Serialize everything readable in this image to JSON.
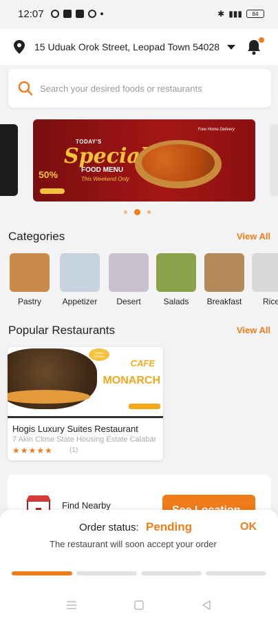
{
  "status_bar": {
    "time": "12:07",
    "battery": "84"
  },
  "address": {
    "text": "15 Uduak Orok Street, Leopad Town 540281, ..."
  },
  "search": {
    "placeholder": "Search your desired foods or restaurants"
  },
  "banner": {
    "line1": "TODAY'S",
    "line2": "Special",
    "line3": "FOOD MENU",
    "line4": "This Weekend Only",
    "discount": "50%",
    "tag": "Free Home Delivery"
  },
  "carousel": {
    "page_count": 3,
    "active_index": 1
  },
  "categories": {
    "title": "Categories",
    "view_all": "View All",
    "items": [
      {
        "label": "Pastry",
        "color": "#c98b4a"
      },
      {
        "label": "Appetizer",
        "color": "#c7d4e0"
      },
      {
        "label": "Desert",
        "color": "#c8c0cf"
      },
      {
        "label": "Salads",
        "color": "#8aa24a"
      },
      {
        "label": "Breakfast",
        "color": "#b58a5a"
      },
      {
        "label": "Rice",
        "color": "#d8d8d8"
      }
    ]
  },
  "popular": {
    "title": "Popular Restaurants",
    "view_all": "View All",
    "restaurant": {
      "name": "Hogis Luxury Suites Restaurant",
      "address": "7 Akin Close State Housing Estate Calabar",
      "rating_count": "(1)",
      "stars": "★★★★★",
      "logo_top": "CAFE",
      "logo_text": "MONARCH",
      "combo": "COMBO OFFERS"
    }
  },
  "nearby": {
    "label": "Find Nearby",
    "button": "See Location"
  },
  "order": {
    "label": "Order status:",
    "status": "Pending",
    "ok": "OK",
    "message": "The restaurant will soon accept your order",
    "steps_done": 1,
    "steps_total": 4
  },
  "colors": {
    "accent": "#f07c1a",
    "banner": "#a51616"
  }
}
